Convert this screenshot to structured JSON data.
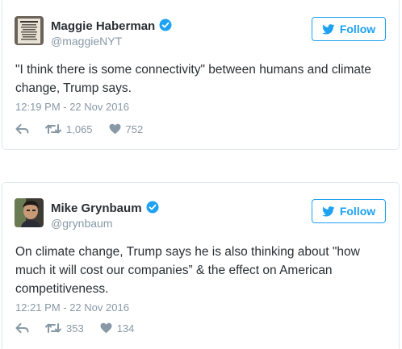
{
  "tweets": [
    {
      "author": {
        "name": "Maggie Haberman",
        "handle": "@maggieNYT",
        "verified": true,
        "avatar_text": "IF IT'S NOT HERE IN THE NEWS"
      },
      "follow_label": "Follow",
      "text": "\"I think there is some connectivity\" between humans and climate change, Trump says.",
      "timestamp": "12:19 PM - 22 Nov 2016",
      "retweets": "1,065",
      "likes": "752"
    },
    {
      "author": {
        "name": "Mike Grynbaum",
        "handle": "@grynbaum",
        "verified": true
      },
      "follow_label": "Follow",
      "text": "On climate change, Trump says he is also thinking about \"how much it will cost our companies” & the effect on American competitiveness.",
      "timestamp": "12:21 PM - 22 Nov 2016",
      "retweets": "353",
      "likes": "134"
    }
  ],
  "colors": {
    "accent": "#1da1f2",
    "text": "#292f33",
    "muted": "#8899a6",
    "border": "#e1e8ed"
  },
  "icons": [
    "verified-badge-icon",
    "twitter-bird-icon",
    "reply-icon",
    "retweet-icon",
    "like-heart-icon"
  ]
}
